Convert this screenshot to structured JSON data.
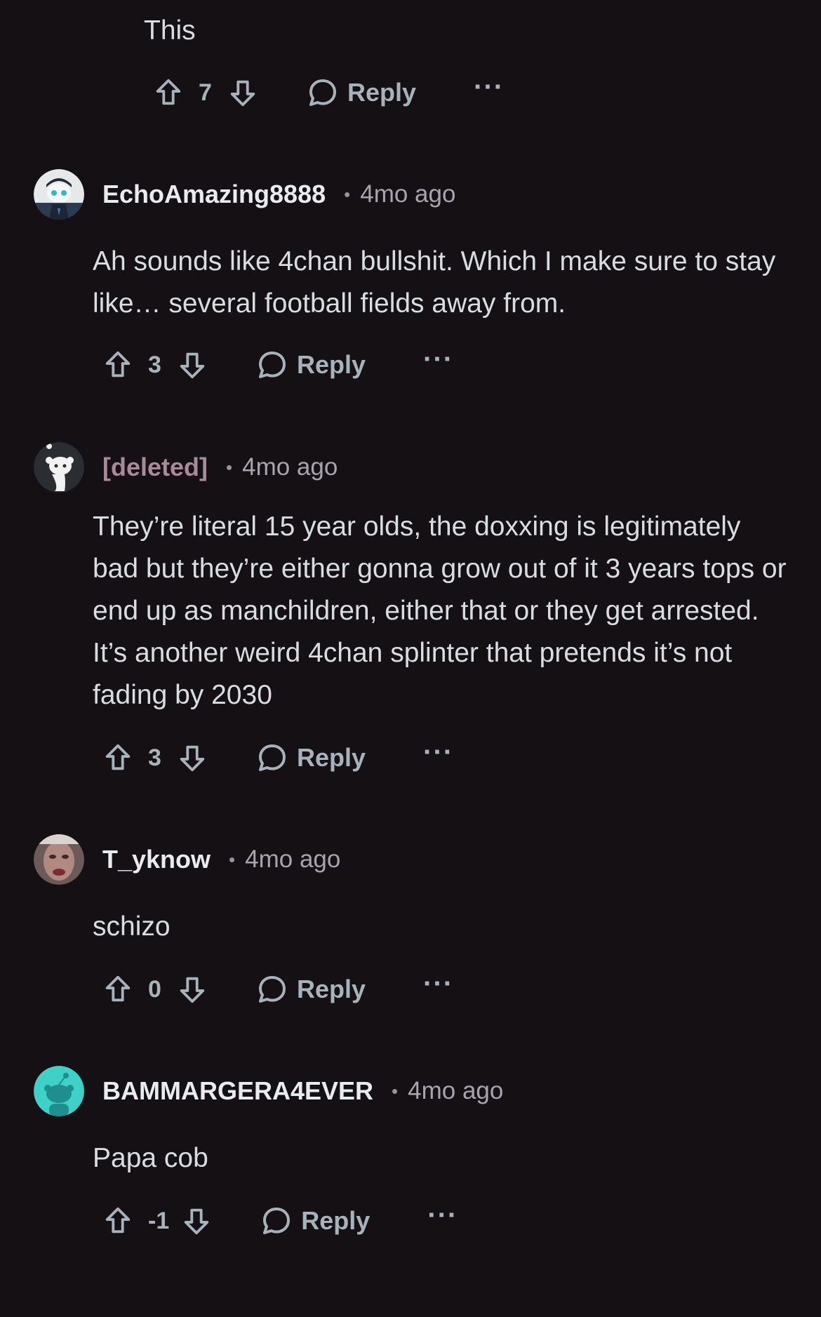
{
  "top_comment": {
    "body": "This",
    "score": "7",
    "reply_label": "Reply"
  },
  "comments": [
    {
      "username": "EchoAmazing8888",
      "time": "4mo ago",
      "body": "Ah sounds like 4chan bullshit. Which I make sure to stay like… several football fields away from.",
      "score": "3",
      "reply_label": "Reply"
    },
    {
      "username": "[deleted]",
      "time": "4mo ago",
      "body": "They’re literal 15 year olds, the doxxing is legitimately bad but they’re either gonna grow out of it 3 years tops or end up as manchildren, either that or they get arrested. It’s another weird 4chan splinter that pretends it’s not fading by 2030",
      "score": "3",
      "reply_label": "Reply"
    },
    {
      "username": "T_yknow",
      "time": "4mo ago",
      "body": "schizo",
      "score": "0",
      "reply_label": "Reply"
    },
    {
      "username": "BAMMARGERA4EVER",
      "time": "4mo ago",
      "body": "Papa cob",
      "score": "-1",
      "reply_label": "Reply"
    }
  ],
  "colors": {
    "background": "#141014",
    "text": "#d8dde1",
    "muted": "#a7b2ba",
    "deleted_name": "#a88a98",
    "snoo_teal": "#3fd0c8"
  },
  "icons": {
    "upvote": "upvote-arrow-icon",
    "downvote": "downvote-arrow-icon",
    "reply": "speech-bubble-icon",
    "more": "ellipsis-icon"
  }
}
